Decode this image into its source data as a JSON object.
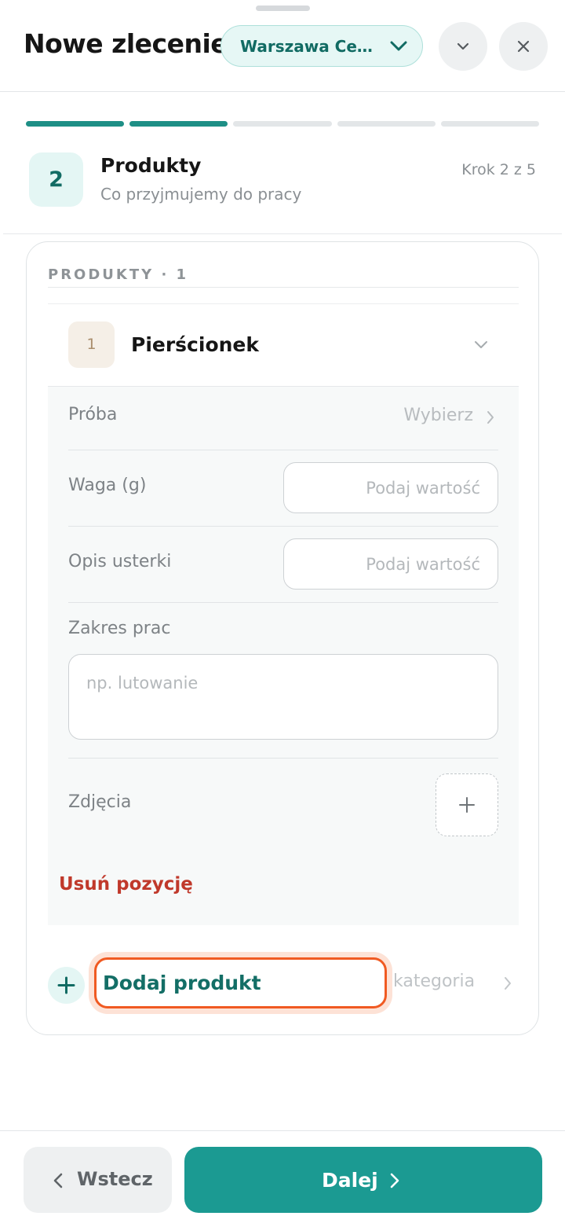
{
  "header": {
    "title": "Nowe zlecenie",
    "location": "Warszawa Ce…",
    "icons": [
      "chevron-down-icon",
      "close-icon"
    ]
  },
  "progress": {
    "total_steps": 5,
    "completed_steps": 2
  },
  "step": {
    "number": "2",
    "title": "Produkty",
    "subtitle": "Co przyjmujemy do pracy",
    "counter": "Krok 2 z 5"
  },
  "products": {
    "section_label": "PRODUKTY · 1",
    "items": [
      {
        "index": "1",
        "name": "Pierścionek",
        "fields": {
          "proba_label": "Próba",
          "proba_value": "Wybierz",
          "waga_label": "Waga (g)",
          "waga_placeholder": "Podaj wartość",
          "opis_label": "Opis usterki",
          "opis_placeholder": "Podaj wartość",
          "zakres_label": "Zakres prac",
          "zakres_placeholder": "np. lutowanie",
          "zdjecia_label": "Zdjęcia"
        },
        "remove_label": "Usuń pozycję"
      }
    ],
    "add_button": "Dodaj produkt",
    "category_label": "kategoria"
  },
  "footer": {
    "back_label": "Wstecz",
    "next_label": "Dalej"
  },
  "colors": {
    "accent": "#1b9a92",
    "accent_dark": "#116b63",
    "danger": "#c0392b",
    "highlight": "#f05a22"
  }
}
